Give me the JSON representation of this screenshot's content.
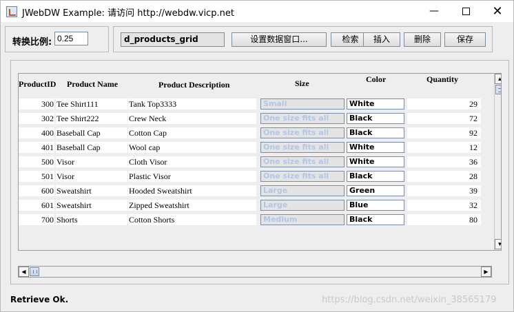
{
  "window": {
    "title": "JWebDW Example: 请访问 http://webdw.vicp.net",
    "minimize_glyph": "—",
    "close_glyph": "✕"
  },
  "toolbar": {
    "ratio_label": "转换比例:",
    "ratio_value": "0.25",
    "datawindow_name": "d_products_grid",
    "set_dw_button": "设置数据窗口...",
    "retrieve_button": "检索",
    "insert_button": "插入",
    "delete_button": "删除",
    "save_button": "保存"
  },
  "grid": {
    "columns": {
      "id": "ProductID",
      "name": "Product Name",
      "description": "Product Description",
      "size": "Size",
      "color": "Color",
      "quantity": "Quantity"
    },
    "rows": [
      {
        "id": "300",
        "name": "Tee Shirt111",
        "description": "Tank Top3333",
        "size": "Small",
        "color": "White",
        "quantity": "29"
      },
      {
        "id": "302",
        "name": "Tee Shirt222",
        "description": "Crew Neck",
        "size": "One size fits all",
        "color": "Black",
        "quantity": "72"
      },
      {
        "id": "400",
        "name": "Baseball Cap",
        "description": "Cotton Cap",
        "size": "One size fits all",
        "color": "Black",
        "quantity": "92"
      },
      {
        "id": "401",
        "name": "Baseball Cap",
        "description": "Wool cap",
        "size": "One size fits all",
        "color": "White",
        "quantity": "12"
      },
      {
        "id": "500",
        "name": "Visor",
        "description": "Cloth Visor",
        "size": "One size fits all",
        "color": "White",
        "quantity": "36"
      },
      {
        "id": "501",
        "name": "Visor",
        "description": "Plastic Visor",
        "size": "One size fits all",
        "color": "Black",
        "quantity": "28"
      },
      {
        "id": "600",
        "name": "Sweatshirt",
        "description": "Hooded Sweatshirt",
        "size": "Large",
        "color": "Green",
        "quantity": "39"
      },
      {
        "id": "601",
        "name": "Sweatshirt",
        "description": "Zipped Sweatshirt",
        "size": "Large",
        "color": "Blue",
        "quantity": "32"
      },
      {
        "id": "700",
        "name": "Shorts",
        "description": "Cotton Shorts",
        "size": "Medium",
        "color": "Black",
        "quantity": "80"
      }
    ]
  },
  "scroll_icons": {
    "up": "▲",
    "down": "▼",
    "left": "◀",
    "right": "▶"
  },
  "status": {
    "text": "Retrieve Ok.",
    "watermark": "https://blog.csdn.net/weixin_38565179"
  }
}
